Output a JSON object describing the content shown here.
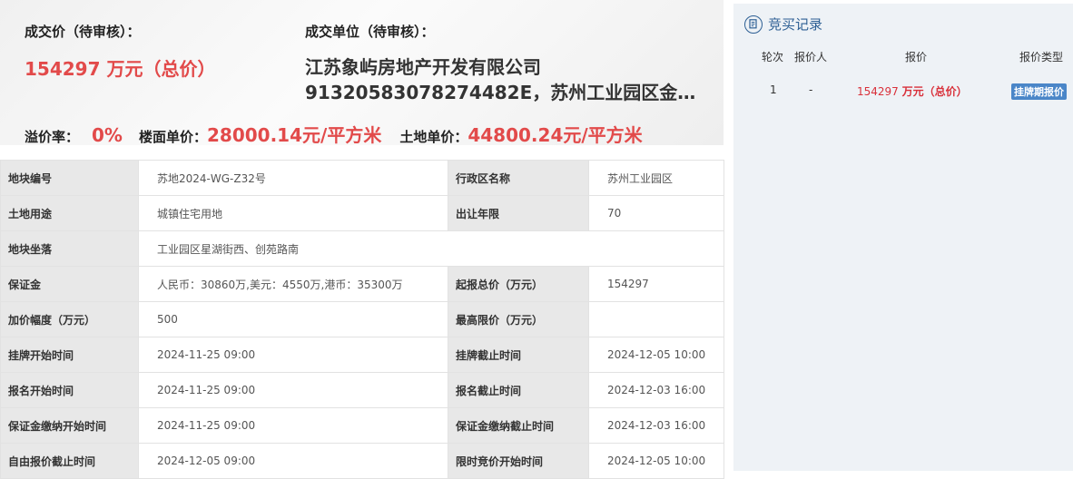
{
  "summary": {
    "deal_price_label": "成交价（待审核）：",
    "deal_price_value": "154297 万元（总价）",
    "deal_unit_label": "成交单位（待审核）：",
    "company_line1": "江苏象屿房地产开发有限公司",
    "company_line2": "91320583078274482E，苏州工业园区金鸡…",
    "premium_label": "溢价率：",
    "premium_value": "0%",
    "floor_price_label": "楼面单价：",
    "floor_price_value": "28000.14元/平方米",
    "land_price_label": "土地单价：",
    "land_price_value": "44800.24元/平方米"
  },
  "detail": {
    "plot_no_label": "地块编号",
    "plot_no_value": "苏地2024-WG-Z32号",
    "district_label": "行政区名称",
    "district_value": "苏州工业园区",
    "use_label": "土地用途",
    "use_value": "城镇住宅用地",
    "term_label": "出让年限",
    "term_value": "70",
    "location_label": "地块坐落",
    "location_value": "工业园区星湖街西、创苑路南",
    "deposit_label": "保证金",
    "deposit_value": "人民币：30860万,美元：4550万,港币：35300万",
    "start_price_label": "起报总价（万元）",
    "start_price_value": "154297",
    "increment_label": "加价幅度（万元）",
    "increment_value": "500",
    "max_price_label": "最高限价（万元）",
    "max_price_value": "",
    "listing_start_label": "挂牌开始时间",
    "listing_start_value": "2024-11-25 09:00",
    "listing_end_label": "挂牌截止时间",
    "listing_end_value": "2024-12-05 10:00",
    "signup_start_label": "报名开始时间",
    "signup_start_value": "2024-11-25 09:00",
    "signup_end_label": "报名截止时间",
    "signup_end_value": "2024-12-03 16:00",
    "deposit_start_label": "保证金缴纳开始时间",
    "deposit_start_value": "2024-11-25 09:00",
    "deposit_end_label": "保证金缴纳截止时间",
    "deposit_end_value": "2024-12-03 16:00",
    "free_bid_end_label": "自由报价截止时间",
    "free_bid_end_value": "2024-12-05 09:00",
    "timed_bid_start_label": "限时竞价开始时间",
    "timed_bid_start_value": "2024-12-05 10:00"
  },
  "records": {
    "title": "竞买记录",
    "headers": {
      "round": "轮次",
      "bidder": "报价人",
      "price": "报价",
      "type": "报价类型"
    },
    "row": {
      "round": "1",
      "bidder": "-",
      "price_num": "154297",
      "price_unit": "万元（总价）",
      "type": "挂牌期报价"
    }
  },
  "colors": {
    "accent_red": "#e24a4a",
    "record_title": "#2d5f94",
    "badge_bg": "#4a86c8"
  }
}
